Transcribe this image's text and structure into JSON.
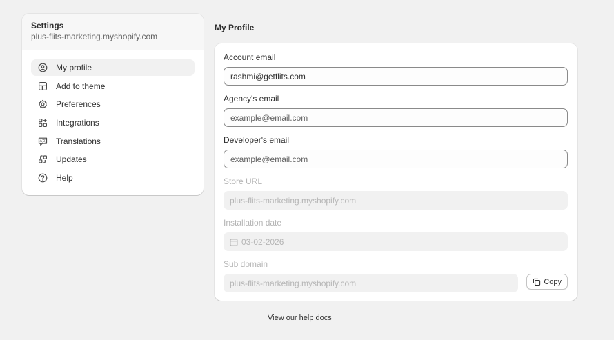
{
  "sidebar": {
    "title": "Settings",
    "store": "plus-flits-marketing.myshopify.com",
    "items": [
      {
        "label": "My profile",
        "icon": "profile-icon"
      },
      {
        "label": "Add to theme",
        "icon": "theme-icon"
      },
      {
        "label": "Preferences",
        "icon": "gear-icon"
      },
      {
        "label": "Integrations",
        "icon": "apps-icon"
      },
      {
        "label": "Translations",
        "icon": "translate-icon"
      },
      {
        "label": "Updates",
        "icon": "updates-icon"
      },
      {
        "label": "Help",
        "icon": "help-icon"
      }
    ]
  },
  "profile": {
    "title": "My Profile",
    "account_email": {
      "label": "Account email",
      "value": "rashmi@getflits.com"
    },
    "agency_email": {
      "label": "Agency's email",
      "placeholder": "example@email.com"
    },
    "developer_email": {
      "label": "Developer's email",
      "placeholder": "example@email.com"
    },
    "store_url": {
      "label": "Store URL",
      "value": "plus-flits-marketing.myshopify.com"
    },
    "installation_date": {
      "label": "Installation date",
      "value": "03-02-2026"
    },
    "sub_domain": {
      "label": "Sub domain",
      "value": "plus-flits-marketing.myshopify.com",
      "copy_label": "Copy"
    }
  },
  "footer": {
    "help_link": "View our help docs"
  }
}
